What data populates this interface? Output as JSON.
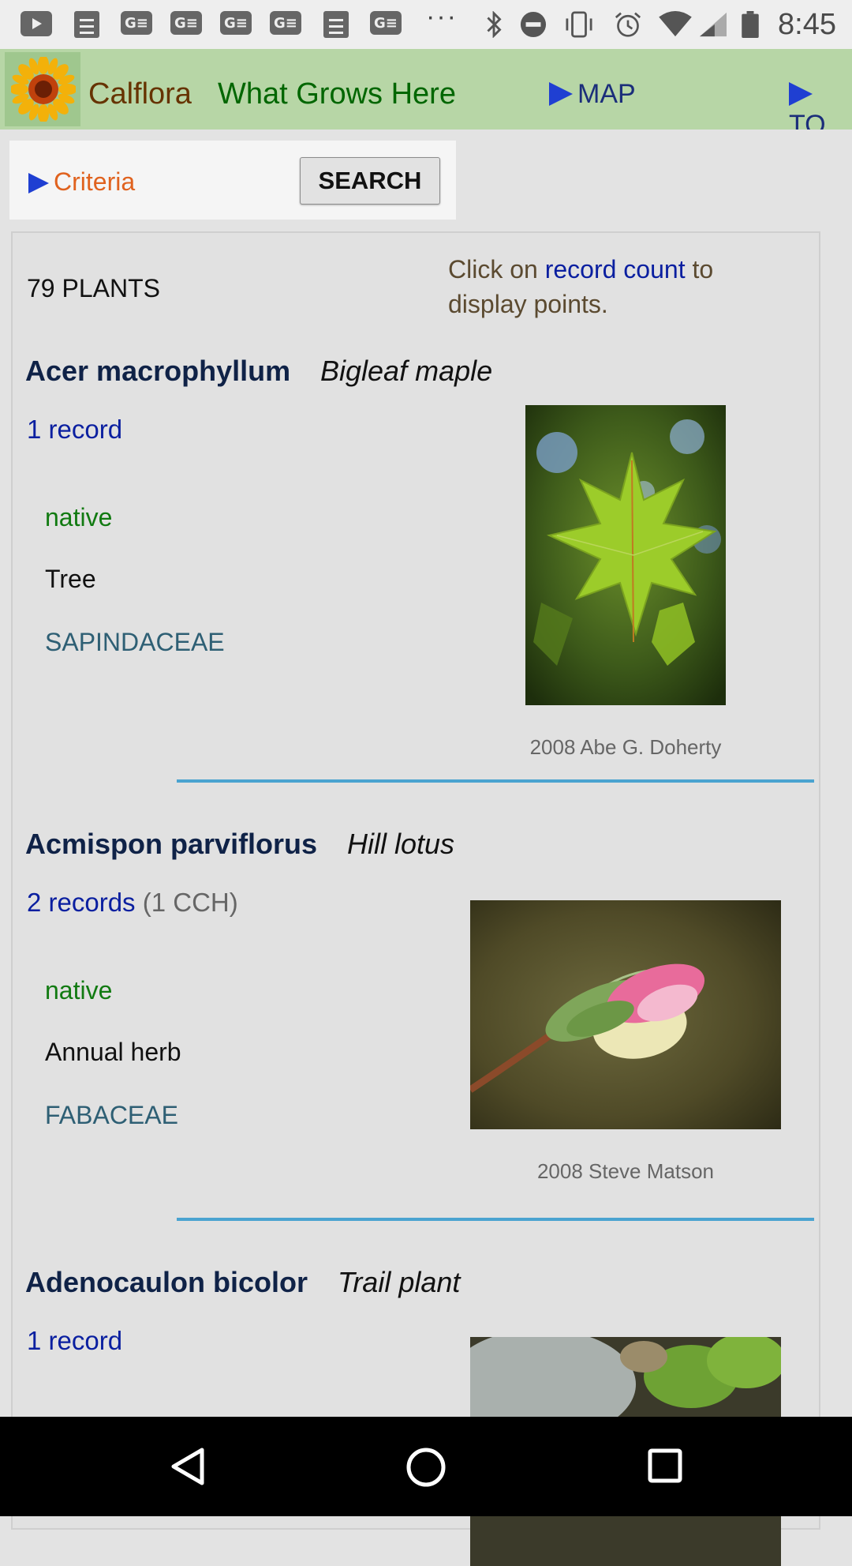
{
  "status_bar": {
    "time": "8:45",
    "icons": [
      "youtube-icon",
      "docs-icon",
      "news-icon",
      "news-icon",
      "news-icon",
      "news-icon",
      "docs-icon",
      "news-icon",
      "more-notifications-icon",
      "bluetooth-icon",
      "do-not-disturb-icon",
      "vibrate-icon",
      "alarm-icon",
      "wifi-icon",
      "signal-icon",
      "battery-icon"
    ]
  },
  "header": {
    "brand": "Calflora",
    "tagline": "What Grows Here",
    "nav_map": "MAP",
    "nav_to": "TO"
  },
  "criteria": {
    "label": "Criteria",
    "search_button": "SEARCH"
  },
  "results": {
    "count": "79 PLANTS",
    "hint_prefix": "Click on",
    "hint_link": "record count",
    "hint_suffix": "to display points."
  },
  "plants": [
    {
      "scientific": "Acer macrophyllum",
      "common": "Bigleaf maple",
      "records": "1 record",
      "records_extra": "",
      "status": "native",
      "habit": "Tree",
      "family": "SAPINDACEAE",
      "photo_credit": "2008 Abe G. Doherty"
    },
    {
      "scientific": "Acmispon parviflorus",
      "common": "Hill lotus",
      "records": "2 records",
      "records_extra": "(1 CCH)",
      "status": "native",
      "habit": "Annual herb",
      "family": "FABACEAE",
      "photo_credit": "2008 Steve Matson"
    },
    {
      "scientific": "Adenocaulon bicolor",
      "common": "Trail plant",
      "records": "1 record",
      "records_extra": ""
    }
  ],
  "colors": {
    "header_bg": "#b7d6a6",
    "brand": "#663300",
    "tagline": "#006600",
    "link": "#0a1fa0",
    "native": "#117a11",
    "family": "#2e5f74",
    "divider": "#4aa3d0",
    "criteria": "#e0621e"
  }
}
